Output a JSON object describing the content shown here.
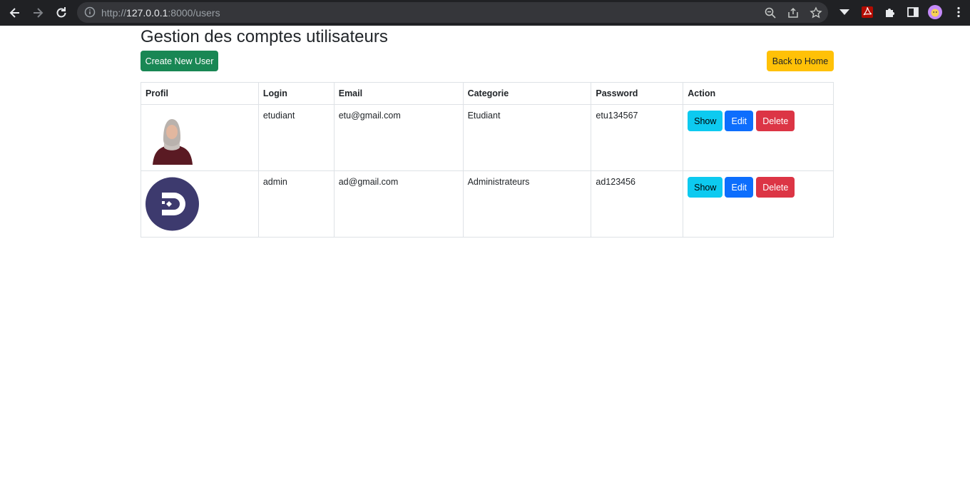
{
  "browser": {
    "url_scheme": "http://",
    "url_host": "127.0.0.1",
    "url_path": ":8000/users"
  },
  "page": {
    "title": "Gestion des comptes utilisateurs",
    "create_label": "Create New User",
    "home_label": "Back to Home"
  },
  "table": {
    "headers": [
      "Profil",
      "Login",
      "Email",
      "Categorie",
      "Password",
      "Action"
    ],
    "rows": [
      {
        "login": "etudiant",
        "email": "etu@gmail.com",
        "categorie": "Etudiant",
        "password": "etu134567",
        "avatar": "person-photo"
      },
      {
        "login": "admin",
        "email": "ad@gmail.com",
        "categorie": "Administrateurs",
        "password": "ad123456",
        "avatar": "logo-circle"
      }
    ],
    "actions": {
      "show": "Show",
      "edit": "Edit",
      "delete": "Delete"
    }
  },
  "colors": {
    "create": "#198754",
    "home": "#ffc107",
    "show": "#0dcaf0",
    "edit": "#0d6efd",
    "delete": "#dc3545",
    "logo": "#3d3a6e"
  }
}
